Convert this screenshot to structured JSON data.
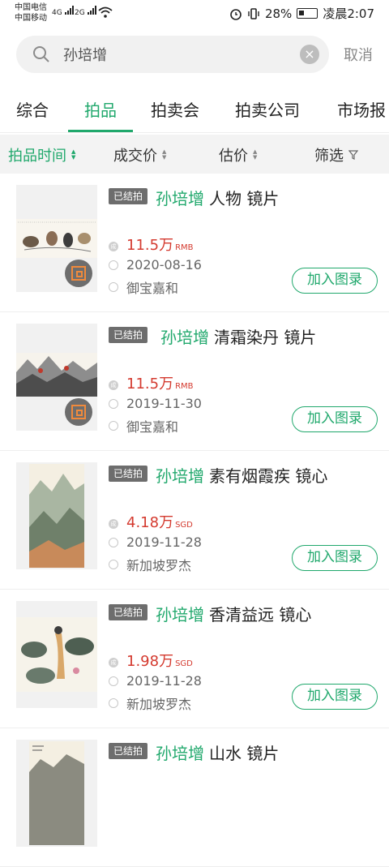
{
  "status_bar": {
    "carrier1": "中国电信",
    "carrier2": "中国移动",
    "net1": "4G",
    "net2": "2G",
    "battery": "28%",
    "time": "凌晨2:07"
  },
  "search": {
    "value": "孙培增",
    "cancel_label": "取消"
  },
  "tabs": [
    {
      "label": "综合"
    },
    {
      "label": "拍品"
    },
    {
      "label": "拍卖会"
    },
    {
      "label": "拍卖公司"
    },
    {
      "label": "市场报"
    }
  ],
  "active_tab": "拍品",
  "sort_bar": {
    "items": [
      {
        "label": "拍品时间"
      },
      {
        "label": "成交价"
      },
      {
        "label": "估价"
      },
      {
        "label": "筛选"
      }
    ]
  },
  "items": [
    {
      "badge": "已结拍",
      "artist": "孙培增",
      "title": "人物 镜片",
      "price": "11.5万",
      "currency": "RMB",
      "date": "2020-08-16",
      "house": "御宝嘉和",
      "button": "加入图录"
    },
    {
      "badge": "已结拍",
      "artist": "孙培增",
      "title": "清霜染丹 镜片",
      "price": "11.5万",
      "currency": "RMB",
      "date": "2019-11-30",
      "house": "御宝嘉和",
      "button": "加入图录"
    },
    {
      "badge": "已结拍",
      "artist": "孙培增",
      "title": "素有烟霞疾 镜心",
      "price": "4.18万",
      "currency": "SGD",
      "date": "2019-11-28",
      "house": "新加坡罗杰",
      "button": "加入图录"
    },
    {
      "badge": "已结拍",
      "artist": "孙培增",
      "title": "香清益远 镜心",
      "price": "1.98万",
      "currency": "SGD",
      "date": "2019-11-28",
      "house": "新加坡罗杰",
      "button": "加入图录"
    },
    {
      "badge": "已结拍",
      "artist": "孙培增",
      "title": "山水 镜片"
    }
  ],
  "colors": {
    "accent": "#20a86c",
    "price": "#d43a2f",
    "badge_bg": "#6d6d6d"
  }
}
